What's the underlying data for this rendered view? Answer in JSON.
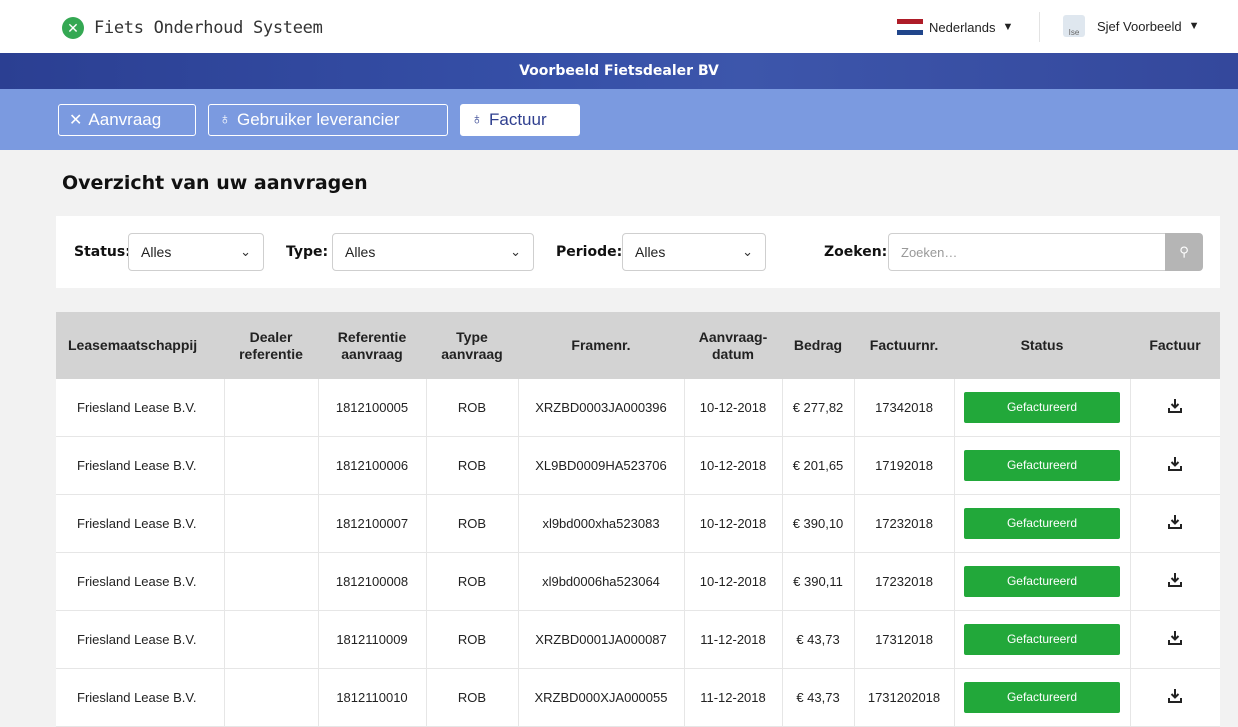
{
  "app": {
    "title": "Fiets Onderhoud Systeem",
    "logo_glyph": "✕",
    "brand_color": "#34a853"
  },
  "header": {
    "language": "Nederlands",
    "flag_colors": [
      "#ae1c28",
      "#ffffff",
      "#21468b"
    ],
    "user_name": "Sjef Voorbeeld",
    "avatar_text": "Ise"
  },
  "dealer": {
    "name": "Voorbeeld Fietsdealer BV"
  },
  "nav": {
    "tabs": [
      {
        "label": "Aanvraag",
        "icon": "tools-icon",
        "glyph": "✕",
        "active": false
      },
      {
        "label": "Gebruiker leverancier",
        "icon": "user-icon",
        "glyph": "♁",
        "active": false
      },
      {
        "label": "Factuur",
        "icon": "user-icon",
        "glyph": "♁",
        "active": true
      }
    ]
  },
  "page": {
    "title": "Overzicht van uw aanvragen"
  },
  "filters": {
    "status_label": "Status:",
    "status_value": "Alles",
    "type_label": "Type:",
    "type_value": "Alles",
    "period_label": "Periode:",
    "period_value": "Alles",
    "search_label": "Zoeken:",
    "search_placeholder": "Zoeken…",
    "chevron": "⌄",
    "search_glyph": "⚲"
  },
  "table": {
    "headers": {
      "lease": "Leasemaatschappij",
      "dealer_ref": "Dealer referentie",
      "ref_request": "Referentie aanvraag",
      "type_request": "Type aanvraag",
      "frame": "Framenr.",
      "date": "Aanvraag-datum",
      "amount": "Bedrag",
      "invoice_nr": "Factuurnr.",
      "status": "Status",
      "invoice": "Factuur"
    },
    "status_color": "#22a83a",
    "rows": [
      {
        "lease": "Friesland Lease B.V.",
        "dealer_ref": "",
        "ref": "1812100005",
        "type": "ROB",
        "frame": "XRZBD0003JA000396",
        "date": "10-12-2018",
        "amount": "€ 277,82",
        "invoice_nr": "17342018",
        "status": "Gefactureerd"
      },
      {
        "lease": "Friesland Lease B.V.",
        "dealer_ref": "",
        "ref": "1812100006",
        "type": "ROB",
        "frame": "XL9BD0009HA523706",
        "date": "10-12-2018",
        "amount": "€ 201,65",
        "invoice_nr": "17192018",
        "status": "Gefactureerd"
      },
      {
        "lease": "Friesland Lease B.V.",
        "dealer_ref": "",
        "ref": "1812100007",
        "type": "ROB",
        "frame": "xl9bd000xha523083",
        "date": "10-12-2018",
        "amount": "€ 390,10",
        "invoice_nr": "17232018",
        "status": "Gefactureerd"
      },
      {
        "lease": "Friesland Lease B.V.",
        "dealer_ref": "",
        "ref": "1812100008",
        "type": "ROB",
        "frame": "xl9bd0006ha523064",
        "date": "10-12-2018",
        "amount": "€ 390,11",
        "invoice_nr": "17232018",
        "status": "Gefactureerd"
      },
      {
        "lease": "Friesland Lease B.V.",
        "dealer_ref": "",
        "ref": "1812110009",
        "type": "ROB",
        "frame": "XRZBD0001JA000087",
        "date": "11-12-2018",
        "amount": "€ 43,73",
        "invoice_nr": "17312018",
        "status": "Gefactureerd"
      },
      {
        "lease": "Friesland Lease B.V.",
        "dealer_ref": "",
        "ref": "1812110010",
        "type": "ROB",
        "frame": "XRZBD000XJA000055",
        "date": "11-12-2018",
        "amount": "€ 43,73",
        "invoice_nr": "1731202018",
        "status": "Gefactureerd"
      }
    ]
  }
}
